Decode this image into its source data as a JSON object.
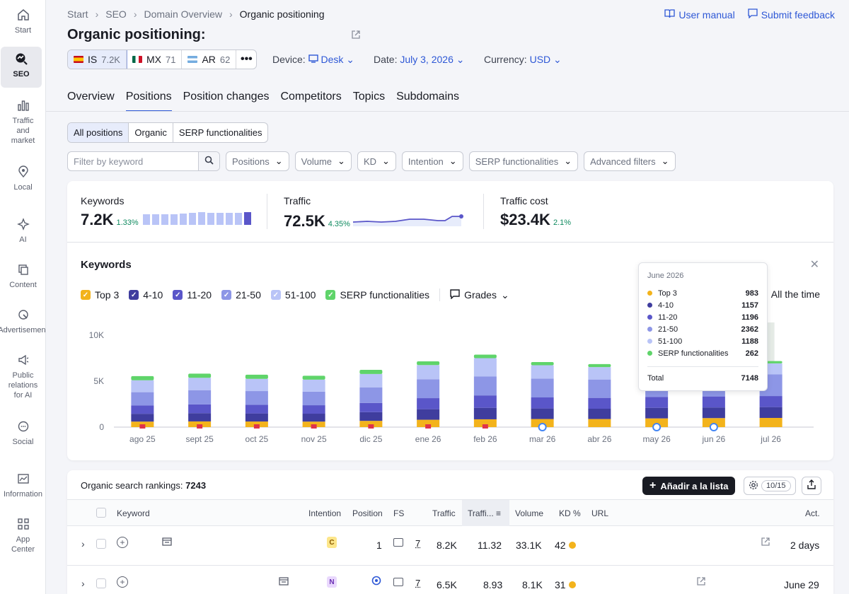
{
  "sidebar": {
    "items": [
      {
        "label": "Start",
        "icon": "home-icon"
      },
      {
        "label": "SEO",
        "icon": "seo-icon",
        "active": true
      },
      {
        "label": "Traffic and market",
        "icon": "bar-chart-icon"
      },
      {
        "label": "Local",
        "icon": "location-pin-icon"
      },
      {
        "label": "AI",
        "icon": "ai-sparkle-icon"
      },
      {
        "label": "Content",
        "icon": "content-icon"
      },
      {
        "label": "Advertisement",
        "icon": "advertisement-icon"
      },
      {
        "label": "Public relations for AI",
        "icon": "megaphone-icon"
      },
      {
        "label": "Social",
        "icon": "chat-bubble-icon"
      },
      {
        "label": "Information",
        "icon": "information-icon"
      },
      {
        "label": "App Center",
        "icon": "app-grid-icon"
      }
    ]
  },
  "breadcrumb": {
    "items": [
      "Start",
      "SEO",
      "Domain Overview"
    ],
    "current": "Organic positioning"
  },
  "header": {
    "title": "Organic positioning:",
    "user_manual": "User manual",
    "submit_feedback": "Submit feedback"
  },
  "databases": [
    {
      "code": "IS",
      "count": "7.2K",
      "selected": true
    },
    {
      "code": "MX",
      "count": "71"
    },
    {
      "code": "AR",
      "count": "62"
    }
  ],
  "device": {
    "label": "Device:",
    "value": "Desk"
  },
  "date": {
    "label": "Date:",
    "value": "July 3, 2026"
  },
  "currency": {
    "label": "Currency:",
    "value": "USD"
  },
  "tabs": [
    "Overview",
    "Positions",
    "Position changes",
    "Competitors",
    "Topics",
    "Subdomains"
  ],
  "active_tab": "Positions",
  "segments": [
    "All positions",
    "Organic",
    "SERP functionalities"
  ],
  "filters": {
    "keyword_placeholder": "Filter by keyword",
    "dropdowns": [
      "Positions",
      "Volume",
      "KD",
      "Intention",
      "SERP functionalities",
      "Advanced filters"
    ]
  },
  "metrics": {
    "keywords": {
      "title": "Keywords",
      "value": "7.2K",
      "change": "1.33%"
    },
    "traffic": {
      "title": "Traffic",
      "value": "72.5K",
      "change": "4.35%"
    },
    "traffic_cost": {
      "title": "Traffic cost",
      "value": "$23.4K",
      "change": "2.1%"
    }
  },
  "chart_section": {
    "title": "Keywords",
    "legend": [
      {
        "name": "Top 3",
        "color": "#f3b31b"
      },
      {
        "name": "4-10",
        "color": "#3f3d9e"
      },
      {
        "name": "11-20",
        "color": "#5a56c9"
      },
      {
        "name": "21-50",
        "color": "#8d96e6"
      },
      {
        "name": "51-100",
        "color": "#b9c4f7"
      },
      {
        "name": "SERP functionalities",
        "color": "#5fd46a"
      }
    ],
    "grades_label": "Grades",
    "range_label": "All the time"
  },
  "chart_data": {
    "type": "bar",
    "stacked": true,
    "categories": [
      "ago 25",
      "sept 25",
      "oct 25",
      "nov 25",
      "dic 25",
      "ene 26",
      "feb 26",
      "mar 26",
      "abr 26",
      "may 26",
      "jun 26",
      "jul 26"
    ],
    "yticks": [
      "0",
      "5K",
      "10K"
    ],
    "ylim": [
      0,
      10000
    ],
    "series": [
      {
        "name": "Top 3",
        "values": [
          600,
          620,
          610,
          600,
          680,
          800,
          850,
          880,
          880,
          950,
          983,
          1000
        ]
      },
      {
        "name": "4-10",
        "values": [
          850,
          900,
          880,
          860,
          950,
          1150,
          1250,
          1150,
          1120,
          1150,
          1157,
          1180
        ]
      },
      {
        "name": "11-20",
        "values": [
          900,
          950,
          930,
          920,
          1000,
          1200,
          1350,
          1200,
          1180,
          1190,
          1196,
          1200
        ]
      },
      {
        "name": "21-50",
        "values": [
          1450,
          1550,
          1500,
          1480,
          1700,
          2050,
          2050,
          2050,
          2000,
          2300,
          2362,
          2350
        ]
      },
      {
        "name": "51-100",
        "values": [
          1300,
          1350,
          1330,
          1300,
          1450,
          1550,
          2000,
          1450,
          1350,
          1180,
          1188,
          1200
        ]
      },
      {
        "name": "SERP functionalities",
        "values": [
          450,
          450,
          450,
          430,
          450,
          400,
          380,
          350,
          330,
          280,
          262,
          250
        ]
      }
    ],
    "markers": [
      "flag",
      "flag",
      "flag",
      "flag",
      "flag",
      "flag",
      "flag",
      "google",
      "",
      "google",
      "google",
      ""
    ]
  },
  "tooltip": {
    "title": "June 2026",
    "rows": [
      {
        "name": "Top 3",
        "value": "983",
        "color": "#f3b31b"
      },
      {
        "name": "4-10",
        "value": "1157",
        "color": "#3f3d9e"
      },
      {
        "name": "11-20",
        "value": "1196",
        "color": "#5a56c9"
      },
      {
        "name": "21-50",
        "value": "2362",
        "color": "#8d96e6"
      },
      {
        "name": "51-100",
        "value": "1188",
        "color": "#b9c4f7"
      },
      {
        "name": "SERP functionalities",
        "value": "262",
        "color": "#5fd46a"
      }
    ],
    "total_label": "Total",
    "total_value": "7148"
  },
  "table": {
    "title": "Organic search rankings:",
    "count": "7243",
    "add_button": "Añadir a la lista",
    "columns_count": "10/15",
    "headers": [
      "Keyword",
      "Intention",
      "Position",
      "FS",
      "Traffic",
      "Traffi...",
      "Volume",
      "KD %",
      "URL",
      "Act."
    ],
    "rows": [
      {
        "intent": "C",
        "position": "1",
        "fs": "7",
        "traffic": "8.2K",
        "traffic_pct": "11.32",
        "volume": "33.1K",
        "kd": "42",
        "updated": "2 days"
      },
      {
        "intent": "N",
        "position": "",
        "fs": "7",
        "traffic": "6.5K",
        "traffic_pct": "8.93",
        "volume": "8.1K",
        "kd": "31",
        "updated": "June 29"
      }
    ]
  }
}
